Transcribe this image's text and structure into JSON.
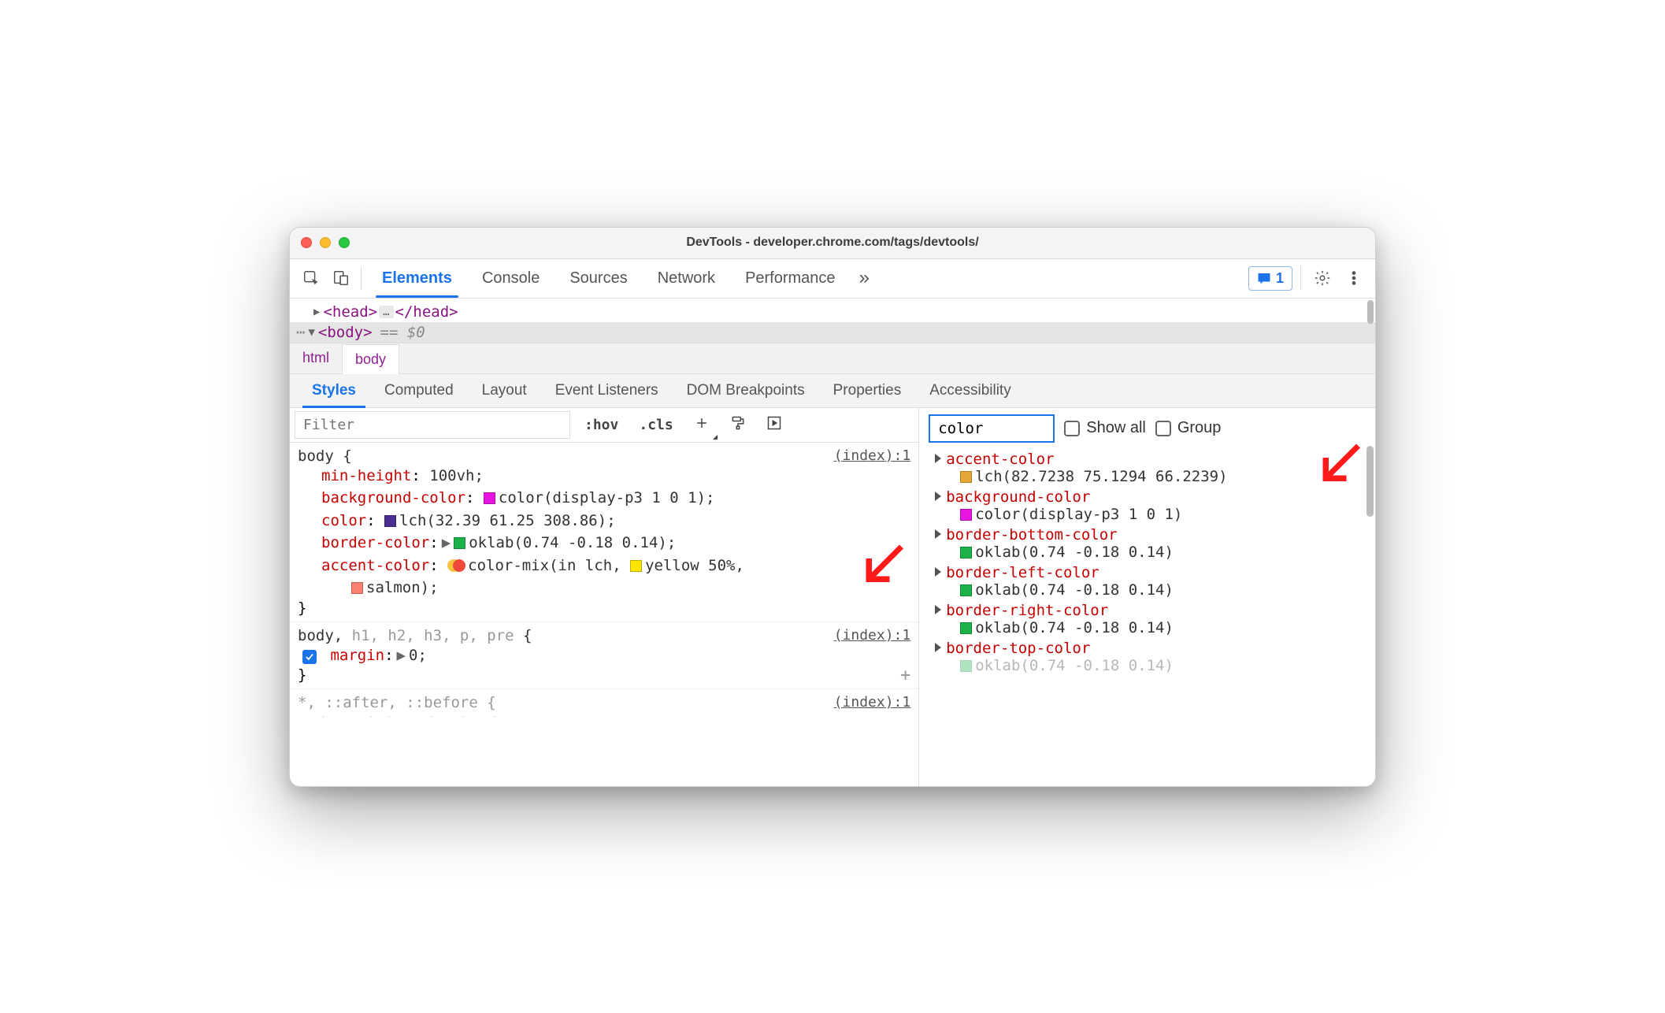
{
  "window": {
    "title": "DevTools - developer.chrome.com/tags/devtools/"
  },
  "toolbar": {
    "tabs": [
      "Elements",
      "Console",
      "Sources",
      "Network",
      "Performance"
    ],
    "active": "Elements",
    "issues_count": "1"
  },
  "dom": {
    "head_open": "<head>",
    "head_close": "</head>",
    "body_open": "<body>",
    "eq": "== $0",
    "ellipsis": "…"
  },
  "breadcrumbs": [
    "html",
    "body"
  ],
  "subtabs": [
    "Styles",
    "Computed",
    "Layout",
    "Event Listeners",
    "DOM Breakpoints",
    "Properties",
    "Accessibility"
  ],
  "subtab_active": "Styles",
  "filterbar": {
    "placeholder": "Filter",
    "hov": ":hov",
    "cls": ".cls"
  },
  "styles_rules": {
    "rule1": {
      "selector": "body {",
      "link": "(index):1",
      "decls": [
        {
          "prop": "min-height",
          "val": "100vh;"
        },
        {
          "prop": "background-color",
          "val": "color(display-p3 1 0 1);",
          "swatch": "#e815e2"
        },
        {
          "prop": "color",
          "val": "lch(32.39 61.25 308.86);",
          "swatch": "#4b2d91"
        },
        {
          "prop": "border-color",
          "has_caret": true,
          "val": "oklab(0.74 -0.18 0.14);",
          "swatch": "#1cb24a"
        },
        {
          "prop": "accent-color",
          "is_mix": true,
          "val": "color-mix(in lch, ",
          "swatch_mid": "#ffe600",
          "val_mid": "yellow 50%,",
          "cont_swatch": "#fa8072",
          "cont_val": "salmon);"
        }
      ],
      "close": "}"
    },
    "rule2": {
      "selector_main": "body, ",
      "selector_dim": "h1, h2, h3, p, pre",
      "selector_end": " {",
      "link": "(index):1",
      "decl_prop": "margin",
      "decl_val": "0;",
      "close": "}"
    },
    "rule3": {
      "selector": "*, ::after, ::before {",
      "link": "(index):1",
      "peek_prop": "box-sizing",
      "peek_val": "border-box;"
    }
  },
  "computed": {
    "filter_value": "color",
    "show_all": "Show all",
    "group": "Group",
    "rows": [
      {
        "prop": "accent-color",
        "swatch": "#e5a837",
        "val": "lch(82.7238 75.1294 66.2239)"
      },
      {
        "prop": "background-color",
        "swatch": "#e815e2",
        "val": "color(display-p3 1 0 1)"
      },
      {
        "prop": "border-bottom-color",
        "swatch": "#1cb24a",
        "val": "oklab(0.74 -0.18 0.14)"
      },
      {
        "prop": "border-left-color",
        "swatch": "#1cb24a",
        "val": "oklab(0.74 -0.18 0.14)"
      },
      {
        "prop": "border-right-color",
        "swatch": "#1cb24a",
        "val": "oklab(0.74 -0.18 0.14)"
      },
      {
        "prop": "border-top-color",
        "swatch": "#1cb24a",
        "val": "oklab(0.74 -0.18 0.14)"
      }
    ]
  }
}
